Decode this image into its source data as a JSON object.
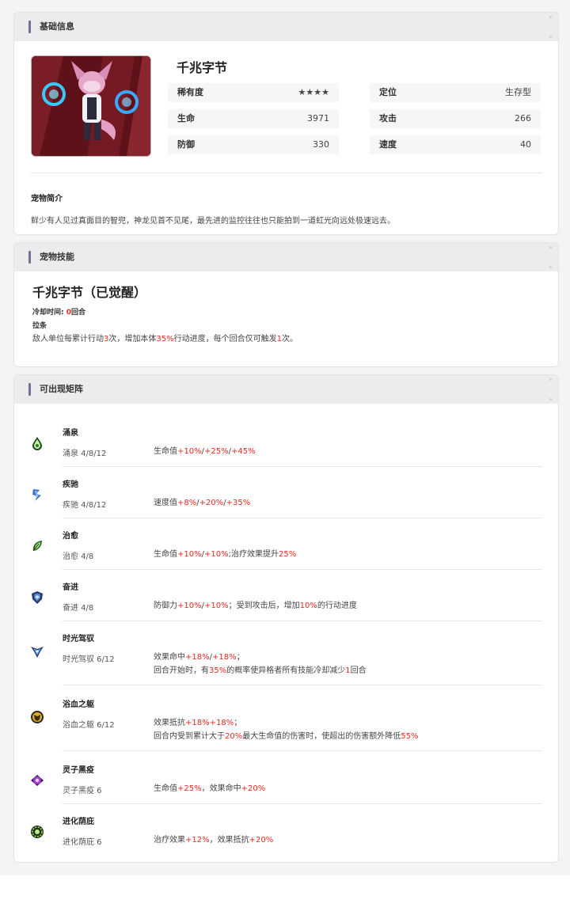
{
  "basic": {
    "header": "基础信息",
    "name": "千兆字节",
    "stats": [
      {
        "label": "稀有度",
        "value": "★★★★"
      },
      {
        "label": "定位",
        "value": "生存型"
      },
      {
        "label": "生命",
        "value": "3971"
      },
      {
        "label": "攻击",
        "value": "266"
      },
      {
        "label": "防御",
        "value": "330"
      },
      {
        "label": "速度",
        "value": "40"
      }
    ],
    "intro_title": "宠物简介",
    "intro_text": "鲜少有人见过真面目的智兜，神龙见首不见尾，最先进的监控往往也只能拍到一道虹光向远处极速远去。"
  },
  "skill": {
    "header": "宠物技能",
    "name": "千兆字节（已觉醒）",
    "cooldown_label": "冷却时间:",
    "cooldown_value": "0",
    "cooldown_unit": "回合",
    "tag": "拉条",
    "desc_parts": [
      "敌人单位每累计行动",
      "3",
      "次，增加本体",
      "35%",
      "行动进度，每个回合仅可触发",
      "1",
      "次。"
    ]
  },
  "formations": {
    "header": "可出现矩阵",
    "items": [
      {
        "name": "涌泉",
        "icon": "spring-drop-icon",
        "tier": "涌泉 4/8/12",
        "lines": [
          [
            [
              "生命值",
              0
            ],
            [
              "+10%",
              1
            ],
            [
              "/",
              0
            ],
            [
              "+25%",
              1
            ],
            [
              "/",
              0
            ],
            [
              "+45%",
              1
            ]
          ]
        ]
      },
      {
        "name": "疾驰",
        "icon": "dash-bolt-icon",
        "tier": "疾驰 4/8/12",
        "lines": [
          [
            [
              "速度值",
              0
            ],
            [
              "+8%",
              1
            ],
            [
              "/",
              0
            ],
            [
              "+20%",
              1
            ],
            [
              "/",
              0
            ],
            [
              "+35%",
              1
            ]
          ]
        ]
      },
      {
        "name": "治愈",
        "icon": "heal-leaf-icon",
        "tier": "治愈 4/8",
        "lines": [
          [
            [
              "生命值",
              0
            ],
            [
              "+10%",
              1
            ],
            [
              "/",
              0
            ],
            [
              "+10%",
              1
            ],
            [
              ";治疗效果提升",
              0
            ],
            [
              "25%",
              1
            ]
          ]
        ]
      },
      {
        "name": "奋进",
        "icon": "shield-emblem-icon",
        "tier": "奋进 4/8",
        "lines": [
          [
            [
              "防御力",
              0
            ],
            [
              "+10%",
              1
            ],
            [
              "/",
              0
            ],
            [
              "+10%",
              1
            ],
            [
              "；受到攻击后，增加",
              0
            ],
            [
              "10%",
              1
            ],
            [
              "的行动进度",
              0
            ]
          ]
        ]
      },
      {
        "name": "时光驾驭",
        "icon": "time-wing-icon",
        "tier": "时光驾驭 6/12",
        "lines": [
          [
            [
              "效果命中",
              0
            ],
            [
              "+18%",
              1
            ],
            [
              "/",
              0
            ],
            [
              "+18%",
              1
            ],
            [
              "；",
              0
            ]
          ],
          [
            [
              "回合开始时，有",
              0
            ],
            [
              "35%",
              1
            ],
            [
              "的概率使异格者所有技能冷却减少",
              0
            ],
            [
              "1",
              1
            ],
            [
              "回合",
              0
            ]
          ]
        ]
      },
      {
        "name": "浴血之躯",
        "icon": "blood-mask-icon",
        "tier": "浴血之躯 6/12",
        "lines": [
          [
            [
              "效果抵抗",
              0
            ],
            [
              "+18%+18%",
              1
            ],
            [
              "；",
              0
            ]
          ],
          [
            [
              "回合内受到累计大于",
              0
            ],
            [
              "20%",
              1
            ],
            [
              "最大生命值的伤害时，使超出的伤害额外降低",
              0
            ],
            [
              "55%",
              1
            ]
          ]
        ]
      },
      {
        "name": "灵子黑疫",
        "icon": "plague-eye-icon",
        "tier": "灵子黑疫 6",
        "lines": [
          [
            [
              "生命值",
              0
            ],
            [
              "+25%",
              1
            ],
            [
              "，效果命中",
              0
            ],
            [
              "+20%",
              1
            ]
          ]
        ]
      },
      {
        "name": "进化荫庇",
        "icon": "evolve-gear-icon",
        "tier": "进化荫庇 6",
        "lines": [
          [
            [
              "治疗效果",
              0
            ],
            [
              "+12%",
              1
            ],
            [
              "，效果抵抗",
              0
            ],
            [
              "+20%",
              1
            ]
          ]
        ]
      }
    ]
  }
}
